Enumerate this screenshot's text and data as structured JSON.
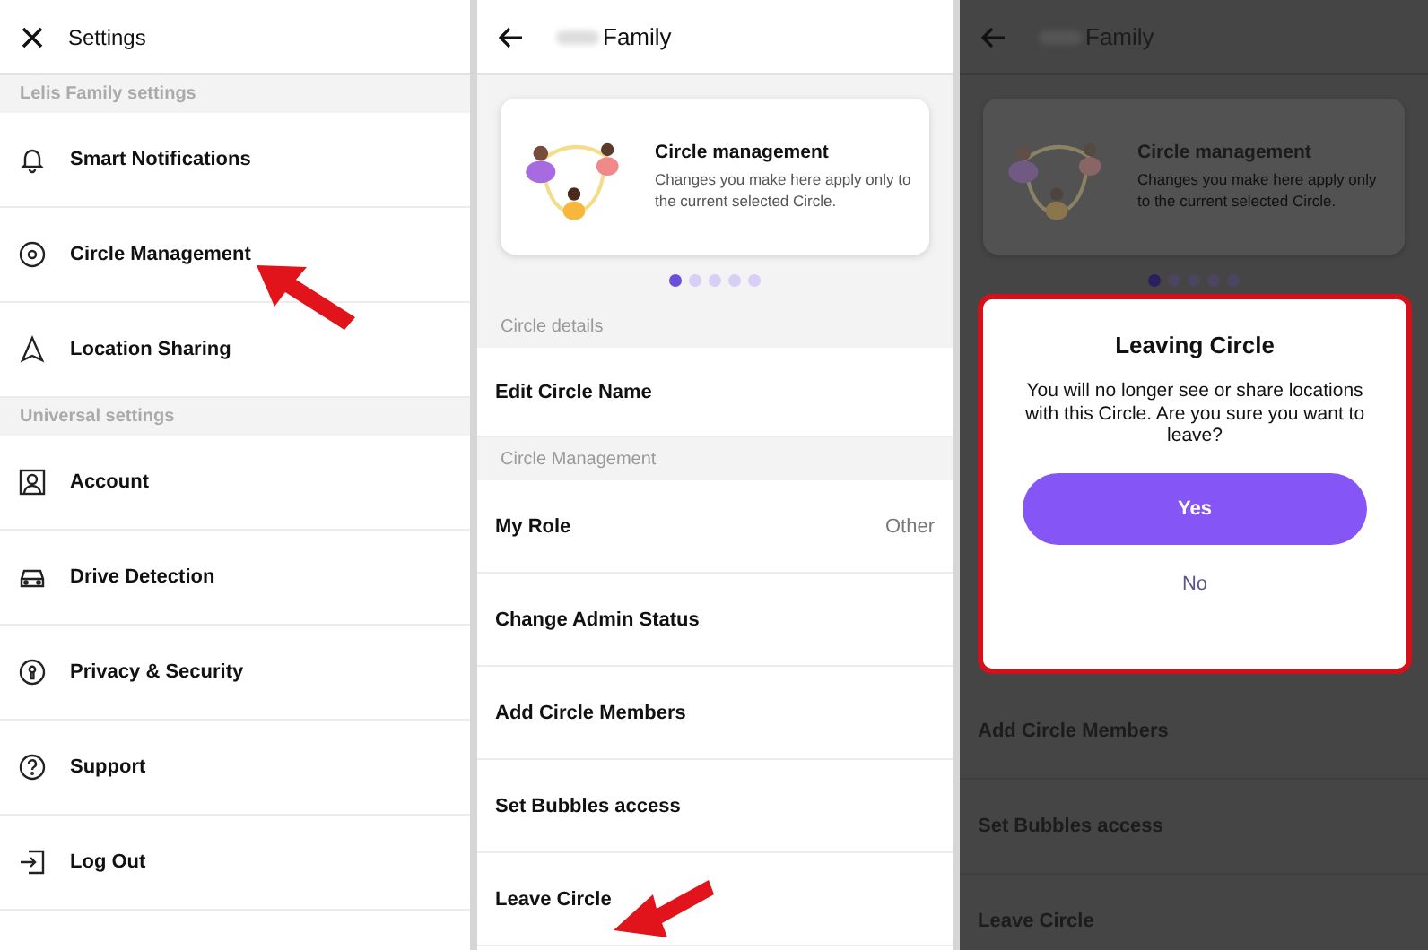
{
  "settings": {
    "title": "Settings",
    "sections": [
      {
        "title": "Lelis Family settings",
        "items": [
          {
            "label": "Smart Notifications"
          },
          {
            "label": "Circle Management"
          },
          {
            "label": "Location Sharing"
          }
        ]
      },
      {
        "title": "Universal settings",
        "items": [
          {
            "label": "Account"
          },
          {
            "label": "Drive Detection"
          },
          {
            "label": "Privacy & Security"
          },
          {
            "label": "Support"
          },
          {
            "label": "Log Out"
          }
        ]
      }
    ]
  },
  "circle": {
    "title": "Family",
    "card": {
      "title": "Circle management",
      "text": "Changes you make here apply only to the current selected Circle."
    },
    "dots": [
      {
        "selected": true
      },
      {
        "selected": false
      },
      {
        "selected": false
      },
      {
        "selected": false
      },
      {
        "selected": false
      }
    ],
    "sections": [
      {
        "title": "Circle details",
        "rows": [
          {
            "label": "Edit Circle Name"
          }
        ]
      },
      {
        "title": "Circle Management",
        "rows": [
          {
            "label": "My Role",
            "value": "Other"
          },
          {
            "label": "Change Admin Status"
          },
          {
            "label": "Add Circle Members"
          },
          {
            "label": "Set Bubbles access"
          },
          {
            "label": "Leave Circle"
          }
        ]
      }
    ]
  },
  "behind_dialog": {
    "title": "Family",
    "card": {
      "title": "Circle management",
      "text": "Changes you make here apply only to the current selected Circle."
    },
    "dots": [
      {
        "selected": true
      },
      {
        "selected": false
      },
      {
        "selected": false
      },
      {
        "selected": false
      },
      {
        "selected": false
      }
    ],
    "rows": [
      {
        "label": "Add Circle Members"
      },
      {
        "label": "Set Bubbles access"
      },
      {
        "label": "Leave Circle"
      }
    ]
  },
  "dialog": {
    "title": "Leaving Circle",
    "message": "You will no longer see or share locations with this Circle. Are you sure you want to leave?",
    "buttons": [
      {
        "label": "Yes",
        "kind": "primary"
      },
      {
        "label": "No",
        "kind": "text"
      }
    ]
  }
}
